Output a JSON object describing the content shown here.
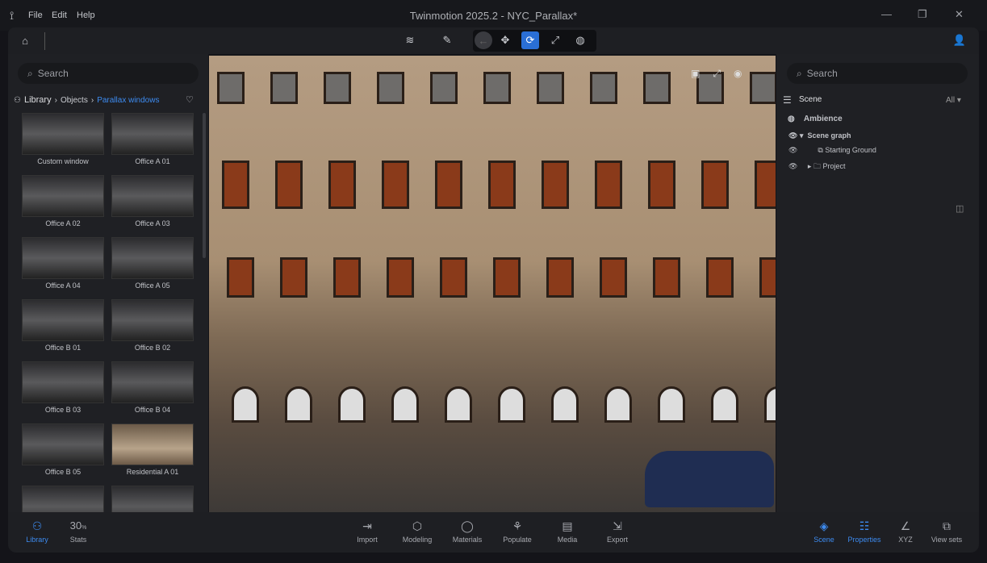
{
  "app": {
    "title": "Twinmotion 2025.2 - NYC_Parallax*",
    "menu": [
      "File",
      "Edit",
      "Help"
    ]
  },
  "left": {
    "search_placeholder": "Search",
    "breadcrumb": [
      "Library",
      "Objects",
      "Parallax windows"
    ],
    "items": [
      "Custom window",
      "Office A 01",
      "Office A 02",
      "Office A 03",
      "Office A 04",
      "Office A 05",
      "Office B 01",
      "Office B 02",
      "Office B 03",
      "Office B 04",
      "Office B 05",
      "Residential A 01"
    ]
  },
  "right": {
    "search_placeholder": "Search",
    "scene_label": "Scene",
    "filter": "All",
    "ambience": "Ambience",
    "scene_graph": "Scene graph",
    "starting_ground": "Starting Ground",
    "project": "Project"
  },
  "bottom": {
    "library": "Library",
    "stats_value": "30",
    "stats_unit": "%",
    "stats": "Stats",
    "center": [
      "Import",
      "Modeling",
      "Materials",
      "Populate",
      "Media",
      "Export"
    ],
    "right": [
      "Scene",
      "Properties",
      "XYZ",
      "View sets"
    ]
  },
  "colors": {
    "accent": "#3d8bf0"
  }
}
